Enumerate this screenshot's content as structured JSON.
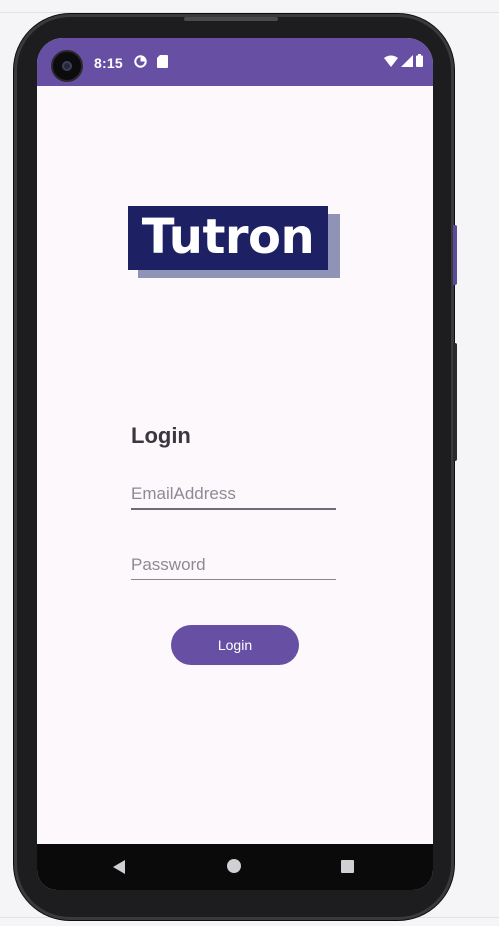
{
  "status_bar": {
    "time": "8:15",
    "icons": [
      "data-saver-icon",
      "sd-card-icon",
      "wifi-icon",
      "signal-icon",
      "battery-icon"
    ],
    "color": "#6750a4"
  },
  "logo": {
    "text": "Tutron"
  },
  "login": {
    "title": "Login",
    "email_placeholder": "EmailAddress",
    "email_value": "",
    "password_placeholder": "Password",
    "password_value": "",
    "button_label": "Login"
  },
  "nav_bar": {
    "icons": [
      "back-icon",
      "home-icon",
      "recents-icon"
    ]
  },
  "colors": {
    "accent": "#6750a4",
    "logo_bg": "#1d2163",
    "logo_shadow": "#8f93b5",
    "screen_bg": "#fdf8fc"
  }
}
